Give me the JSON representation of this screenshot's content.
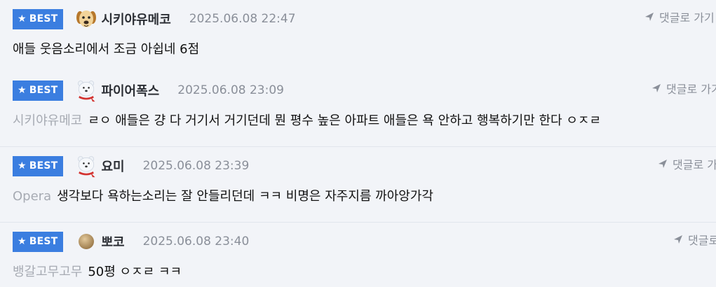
{
  "badge_label": "BEST",
  "reply_label": "댓글로 가기",
  "comments": [
    {
      "nickname": "시키야유메코",
      "avatar_icon": "dog-avatar-icon",
      "date": "2025.06.08 22:47",
      "mention": "",
      "text": "애들 웃음소리에서 조금 아쉽네 6점"
    },
    {
      "nickname": "파이어폭스",
      "avatar_icon": "polar-bear-avatar-icon",
      "date": "2025.06.08 23:09",
      "mention": "시키야유메코",
      "text": "ㄹㅇ 애들은 걍 다 거기서 거기던데 뭔 평수 높은 아파트 애들은 욕 안하고 행복하기만 한다 ㅇㅈㄹ"
    },
    {
      "nickname": "요미",
      "avatar_icon": "polar-bear-avatar-icon",
      "date": "2025.06.08 23:39",
      "mention": "Opera",
      "text": "생각보다 욕하는소리는 잘 안들리던데 ㅋㅋ 비명은 자주지름 까아앙가각"
    },
    {
      "nickname": "뽀코",
      "avatar_icon": "dot-avatar-icon",
      "date": "2025.06.08 23:40",
      "mention": "뱅갈고무고무",
      "text": "50평 ㅇㅈㄹ ㅋㅋ"
    }
  ],
  "colors": {
    "badge": "#3b7ee0",
    "background": "#f2f4f8",
    "date": "#8a8f99",
    "mention": "#a7abb3"
  }
}
